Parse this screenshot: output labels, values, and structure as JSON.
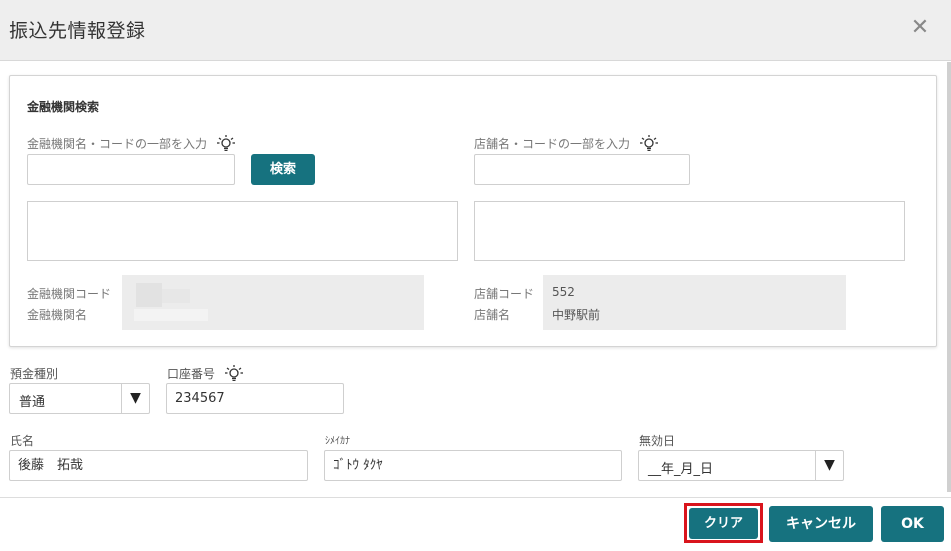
{
  "dialog": {
    "title": "振込先情報登録",
    "close_icon": "close-icon"
  },
  "bank_search": {
    "section_title": "金融機関検索",
    "bank_label": "金融機関名・コードの一部を入力",
    "bank_input_value": "",
    "search_button": "検索",
    "branch_label": "店舗名・コードの一部を入力",
    "branch_input_value": "",
    "bank_code_label": "金融機関コード",
    "bank_name_label": "金融機関名",
    "branch_code_label": "店舗コード",
    "branch_name_label": "店舗名",
    "branch_code_value": "552",
    "branch_name_value": "中野駅前"
  },
  "account": {
    "deposit_type_label": "預金種別",
    "deposit_type_value": "普通",
    "account_number_label": "口座番号",
    "account_number_value": "234567",
    "name_label": "氏名",
    "name_value": "後藤　拓哉",
    "kana_label": "ｼﾒｲｶﾅ",
    "kana_value": "ｺﾞﾄｳ ﾀｸﾔ",
    "invalid_date_label": "無効日",
    "invalid_date_value": "__年_月_日"
  },
  "footer": {
    "clear_button": "クリア",
    "cancel_button": "キャンセル",
    "ok_button": "OK"
  },
  "colors": {
    "accent": "#16727f",
    "highlight": "#d9141c",
    "header_bg": "#eeeeee"
  },
  "icons": {
    "hint": "lightbulb-icon",
    "dropdown": "triangle-down-icon"
  }
}
